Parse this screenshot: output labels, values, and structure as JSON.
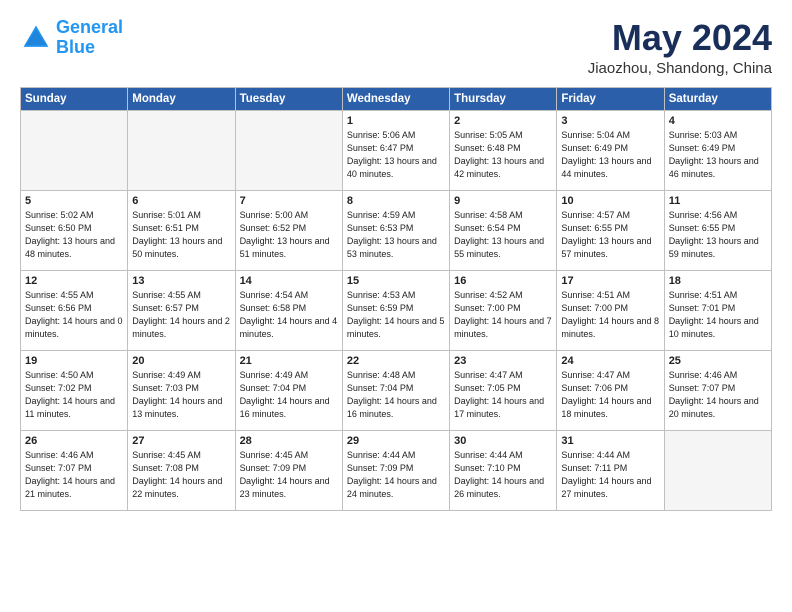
{
  "logo": {
    "line1": "General",
    "line2": "Blue"
  },
  "title": "May 2024",
  "location": "Jiaozhou, Shandong, China",
  "days_of_week": [
    "Sunday",
    "Monday",
    "Tuesday",
    "Wednesday",
    "Thursday",
    "Friday",
    "Saturday"
  ],
  "weeks": [
    [
      {
        "num": "",
        "sunrise": "",
        "sunset": "",
        "daylight": ""
      },
      {
        "num": "",
        "sunrise": "",
        "sunset": "",
        "daylight": ""
      },
      {
        "num": "",
        "sunrise": "",
        "sunset": "",
        "daylight": ""
      },
      {
        "num": "1",
        "sunrise": "Sunrise: 5:06 AM",
        "sunset": "Sunset: 6:47 PM",
        "daylight": "Daylight: 13 hours and 40 minutes."
      },
      {
        "num": "2",
        "sunrise": "Sunrise: 5:05 AM",
        "sunset": "Sunset: 6:48 PM",
        "daylight": "Daylight: 13 hours and 42 minutes."
      },
      {
        "num": "3",
        "sunrise": "Sunrise: 5:04 AM",
        "sunset": "Sunset: 6:49 PM",
        "daylight": "Daylight: 13 hours and 44 minutes."
      },
      {
        "num": "4",
        "sunrise": "Sunrise: 5:03 AM",
        "sunset": "Sunset: 6:49 PM",
        "daylight": "Daylight: 13 hours and 46 minutes."
      }
    ],
    [
      {
        "num": "5",
        "sunrise": "Sunrise: 5:02 AM",
        "sunset": "Sunset: 6:50 PM",
        "daylight": "Daylight: 13 hours and 48 minutes."
      },
      {
        "num": "6",
        "sunrise": "Sunrise: 5:01 AM",
        "sunset": "Sunset: 6:51 PM",
        "daylight": "Daylight: 13 hours and 50 minutes."
      },
      {
        "num": "7",
        "sunrise": "Sunrise: 5:00 AM",
        "sunset": "Sunset: 6:52 PM",
        "daylight": "Daylight: 13 hours and 51 minutes."
      },
      {
        "num": "8",
        "sunrise": "Sunrise: 4:59 AM",
        "sunset": "Sunset: 6:53 PM",
        "daylight": "Daylight: 13 hours and 53 minutes."
      },
      {
        "num": "9",
        "sunrise": "Sunrise: 4:58 AM",
        "sunset": "Sunset: 6:54 PM",
        "daylight": "Daylight: 13 hours and 55 minutes."
      },
      {
        "num": "10",
        "sunrise": "Sunrise: 4:57 AM",
        "sunset": "Sunset: 6:55 PM",
        "daylight": "Daylight: 13 hours and 57 minutes."
      },
      {
        "num": "11",
        "sunrise": "Sunrise: 4:56 AM",
        "sunset": "Sunset: 6:55 PM",
        "daylight": "Daylight: 13 hours and 59 minutes."
      }
    ],
    [
      {
        "num": "12",
        "sunrise": "Sunrise: 4:55 AM",
        "sunset": "Sunset: 6:56 PM",
        "daylight": "Daylight: 14 hours and 0 minutes."
      },
      {
        "num": "13",
        "sunrise": "Sunrise: 4:55 AM",
        "sunset": "Sunset: 6:57 PM",
        "daylight": "Daylight: 14 hours and 2 minutes."
      },
      {
        "num": "14",
        "sunrise": "Sunrise: 4:54 AM",
        "sunset": "Sunset: 6:58 PM",
        "daylight": "Daylight: 14 hours and 4 minutes."
      },
      {
        "num": "15",
        "sunrise": "Sunrise: 4:53 AM",
        "sunset": "Sunset: 6:59 PM",
        "daylight": "Daylight: 14 hours and 5 minutes."
      },
      {
        "num": "16",
        "sunrise": "Sunrise: 4:52 AM",
        "sunset": "Sunset: 7:00 PM",
        "daylight": "Daylight: 14 hours and 7 minutes."
      },
      {
        "num": "17",
        "sunrise": "Sunrise: 4:51 AM",
        "sunset": "Sunset: 7:00 PM",
        "daylight": "Daylight: 14 hours and 8 minutes."
      },
      {
        "num": "18",
        "sunrise": "Sunrise: 4:51 AM",
        "sunset": "Sunset: 7:01 PM",
        "daylight": "Daylight: 14 hours and 10 minutes."
      }
    ],
    [
      {
        "num": "19",
        "sunrise": "Sunrise: 4:50 AM",
        "sunset": "Sunset: 7:02 PM",
        "daylight": "Daylight: 14 hours and 11 minutes."
      },
      {
        "num": "20",
        "sunrise": "Sunrise: 4:49 AM",
        "sunset": "Sunset: 7:03 PM",
        "daylight": "Daylight: 14 hours and 13 minutes."
      },
      {
        "num": "21",
        "sunrise": "Sunrise: 4:49 AM",
        "sunset": "Sunset: 7:04 PM",
        "daylight": "Daylight: 14 hours and 16 minutes."
      },
      {
        "num": "22",
        "sunrise": "Sunrise: 4:48 AM",
        "sunset": "Sunset: 7:04 PM",
        "daylight": "Daylight: 14 hours and 16 minutes."
      },
      {
        "num": "23",
        "sunrise": "Sunrise: 4:47 AM",
        "sunset": "Sunset: 7:05 PM",
        "daylight": "Daylight: 14 hours and 17 minutes."
      },
      {
        "num": "24",
        "sunrise": "Sunrise: 4:47 AM",
        "sunset": "Sunset: 7:06 PM",
        "daylight": "Daylight: 14 hours and 18 minutes."
      },
      {
        "num": "25",
        "sunrise": "Sunrise: 4:46 AM",
        "sunset": "Sunset: 7:07 PM",
        "daylight": "Daylight: 14 hours and 20 minutes."
      }
    ],
    [
      {
        "num": "26",
        "sunrise": "Sunrise: 4:46 AM",
        "sunset": "Sunset: 7:07 PM",
        "daylight": "Daylight: 14 hours and 21 minutes."
      },
      {
        "num": "27",
        "sunrise": "Sunrise: 4:45 AM",
        "sunset": "Sunset: 7:08 PM",
        "daylight": "Daylight: 14 hours and 22 minutes."
      },
      {
        "num": "28",
        "sunrise": "Sunrise: 4:45 AM",
        "sunset": "Sunset: 7:09 PM",
        "daylight": "Daylight: 14 hours and 23 minutes."
      },
      {
        "num": "29",
        "sunrise": "Sunrise: 4:44 AM",
        "sunset": "Sunset: 7:09 PM",
        "daylight": "Daylight: 14 hours and 24 minutes."
      },
      {
        "num": "30",
        "sunrise": "Sunrise: 4:44 AM",
        "sunset": "Sunset: 7:10 PM",
        "daylight": "Daylight: 14 hours and 26 minutes."
      },
      {
        "num": "31",
        "sunrise": "Sunrise: 4:44 AM",
        "sunset": "Sunset: 7:11 PM",
        "daylight": "Daylight: 14 hours and 27 minutes."
      },
      {
        "num": "",
        "sunrise": "",
        "sunset": "",
        "daylight": ""
      }
    ]
  ]
}
